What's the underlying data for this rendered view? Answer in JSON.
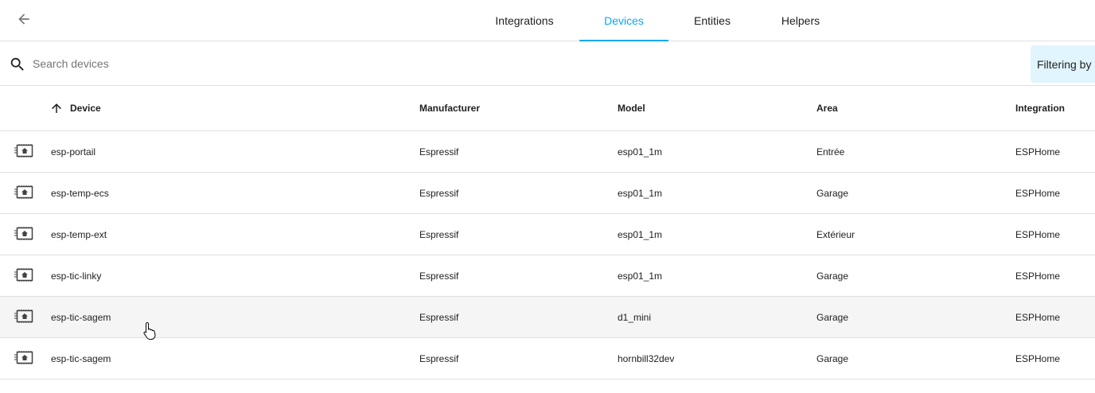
{
  "tabs": [
    {
      "label": "Integrations",
      "active": false
    },
    {
      "label": "Devices",
      "active": true
    },
    {
      "label": "Entities",
      "active": false
    },
    {
      "label": "Helpers",
      "active": false
    }
  ],
  "search": {
    "placeholder": "Search devices",
    "value": ""
  },
  "filter_chip": {
    "label": "Filtering by i"
  },
  "table": {
    "columns": [
      "Device",
      "Manufacturer",
      "Model",
      "Area",
      "Integration"
    ],
    "sort_column": "Device",
    "sort_direction": "ascending",
    "rows": [
      {
        "device": "esp-portail",
        "manufacturer": "Espressif",
        "model": "esp01_1m",
        "area": "Entrée",
        "integration": "ESPHome"
      },
      {
        "device": "esp-temp-ecs",
        "manufacturer": "Espressif",
        "model": "esp01_1m",
        "area": "Garage",
        "integration": "ESPHome"
      },
      {
        "device": "esp-temp-ext",
        "manufacturer": "Espressif",
        "model": "esp01_1m",
        "area": "Extérieur",
        "integration": "ESPHome"
      },
      {
        "device": "esp-tic-linky",
        "manufacturer": "Espressif",
        "model": "esp01_1m",
        "area": "Garage",
        "integration": "ESPHome"
      },
      {
        "device": "esp-tic-sagem",
        "manufacturer": "Espressif",
        "model": "d1_mini",
        "area": "Garage",
        "integration": "ESPHome"
      },
      {
        "device": "esp-tic-sagem",
        "manufacturer": "Espressif",
        "model": "hornbill32dev",
        "area": "Garage",
        "integration": "ESPHome"
      }
    ]
  },
  "colors": {
    "accent": "#03a9f4",
    "filter_chip_bg": "#e1f5fe",
    "divider": "#e0e0e0",
    "hover_row": "#f5f5f5"
  },
  "icons": {
    "back": "arrow-left-icon",
    "search": "search-icon",
    "sort": "arrow-up-icon",
    "device": "chip-icon"
  }
}
